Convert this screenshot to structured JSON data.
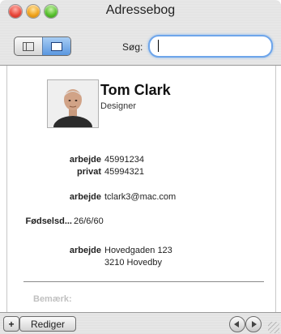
{
  "window": {
    "title": "Adressebog"
  },
  "toolbar": {
    "search_label": "Søg:",
    "search_value": ""
  },
  "card": {
    "name": "Tom Clark",
    "job_title": "Designer",
    "phones": [
      {
        "label": "arbejde",
        "value": "45991234"
      },
      {
        "label": "privat",
        "value": "45994321"
      }
    ],
    "email": {
      "label": "arbejde",
      "value": "tclark3@mac.com"
    },
    "birthday": {
      "label": "Fødselsd...",
      "value": "26/6/60"
    },
    "address": {
      "label": "arbejde",
      "line1": "Hovedgaden 123",
      "line2": "3210  Hovedby"
    },
    "note_label": "Bemærk:"
  },
  "bottombar": {
    "add_label": "+",
    "edit_label": "Rediger"
  },
  "icons": {
    "close": "close-button",
    "minimize": "minimize-button",
    "zoom": "zoom-button",
    "prev": "triangle-left-icon",
    "next": "triangle-right-icon"
  }
}
